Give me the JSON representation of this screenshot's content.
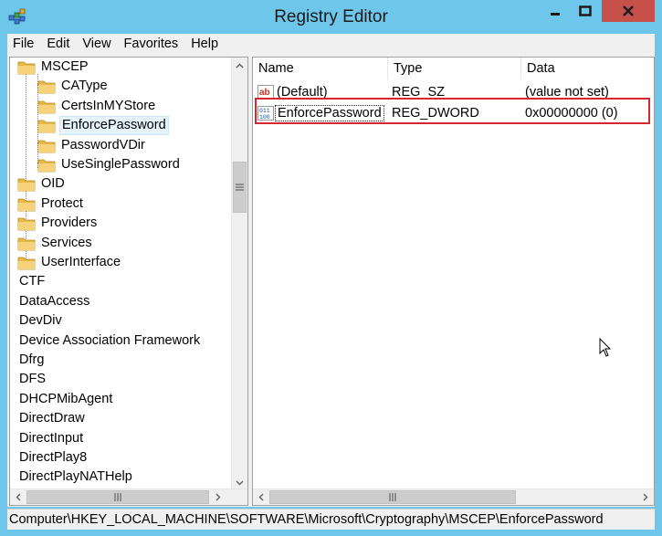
{
  "window": {
    "title": "Registry Editor"
  },
  "menu": [
    "File",
    "Edit",
    "View",
    "Favorites",
    "Help"
  ],
  "tree": {
    "items": [
      {
        "label": "MSCEP",
        "level": 1
      },
      {
        "label": "CAType",
        "level": 2
      },
      {
        "label": "CertsInMYStore",
        "level": 2
      },
      {
        "label": "EnforcePassword",
        "level": 2,
        "selected": true
      },
      {
        "label": "PasswordVDir",
        "level": 2
      },
      {
        "label": "UseSinglePassword",
        "level": 2
      },
      {
        "label": "OID",
        "level": 1
      },
      {
        "label": "Protect",
        "level": 1
      },
      {
        "label": "Providers",
        "level": 1
      },
      {
        "label": "Services",
        "level": 1
      },
      {
        "label": "UserInterface",
        "level": 1
      },
      {
        "label": "CTF",
        "level": 0
      },
      {
        "label": "DataAccess",
        "level": 0
      },
      {
        "label": "DevDiv",
        "level": 0
      },
      {
        "label": "Device Association Framework",
        "level": 0
      },
      {
        "label": "Dfrg",
        "level": 0
      },
      {
        "label": "DFS",
        "level": 0
      },
      {
        "label": "DHCPMibAgent",
        "level": 0
      },
      {
        "label": "DirectDraw",
        "level": 0
      },
      {
        "label": "DirectInput",
        "level": 0
      },
      {
        "label": "DirectPlay8",
        "level": 0
      },
      {
        "label": "DirectPlayNATHelp",
        "level": 0
      }
    ]
  },
  "list": {
    "columns": [
      "Name",
      "Type",
      "Data"
    ],
    "rows": [
      {
        "icon": "string-value-icon",
        "name": "(Default)",
        "type": "REG_SZ",
        "data": "(value not set)"
      },
      {
        "icon": "dword-value-icon",
        "name": "EnforcePassword",
        "type": "REG_DWORD",
        "data": "0x00000000 (0)"
      }
    ]
  },
  "status": {
    "path": "Computer\\HKEY_LOCAL_MACHINE\\SOFTWARE\\Microsoft\\Cryptography\\MSCEP\\EnforcePassword"
  },
  "colors": {
    "titlebar": "#6ec6ea",
    "close": "#c7504b",
    "highlight": "#d8262f"
  }
}
